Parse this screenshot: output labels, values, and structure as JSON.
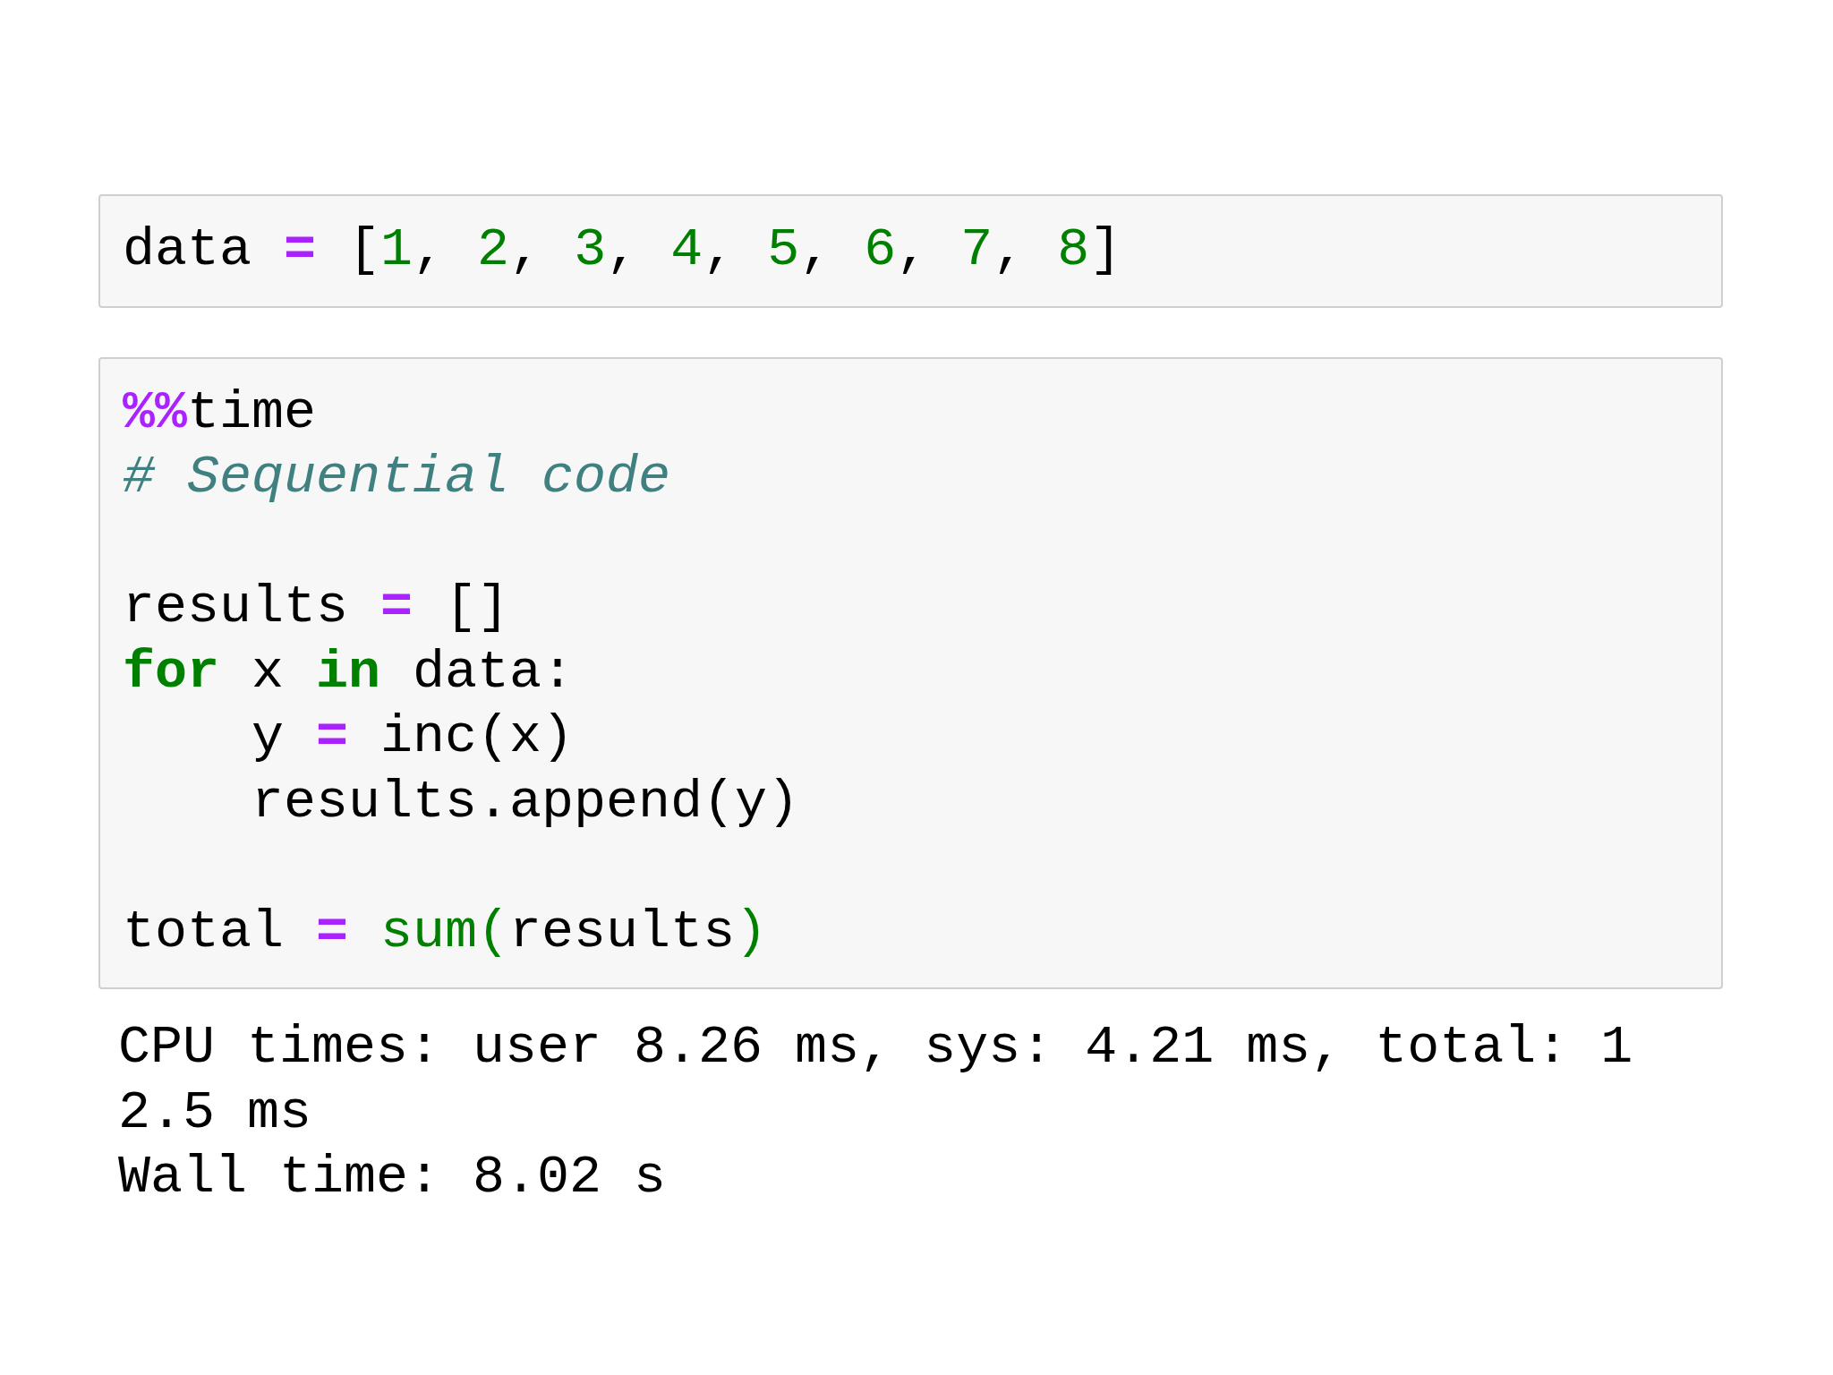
{
  "cells": [
    {
      "lines": [
        {
          "kind": "code",
          "tokens": [
            {
              "t": "data ",
              "kind": "name"
            },
            {
              "t": "=",
              "kind": "op"
            },
            {
              "t": " [",
              "kind": "name"
            },
            {
              "t": "1",
              "kind": "num"
            },
            {
              "t": ", ",
              "kind": "name"
            },
            {
              "t": "2",
              "kind": "num"
            },
            {
              "t": ", ",
              "kind": "name"
            },
            {
              "t": "3",
              "kind": "num"
            },
            {
              "t": ", ",
              "kind": "name"
            },
            {
              "t": "4",
              "kind": "num"
            },
            {
              "t": ", ",
              "kind": "name"
            },
            {
              "t": "5",
              "kind": "num"
            },
            {
              "t": ", ",
              "kind": "name"
            },
            {
              "t": "6",
              "kind": "num"
            },
            {
              "t": ", ",
              "kind": "name"
            },
            {
              "t": "7",
              "kind": "num"
            },
            {
              "t": ", ",
              "kind": "name"
            },
            {
              "t": "8",
              "kind": "num"
            },
            {
              "t": "]",
              "kind": "name"
            }
          ]
        }
      ]
    },
    {
      "lines": [
        {
          "kind": "code",
          "tokens": [
            {
              "t": "%%",
              "kind": "magic"
            },
            {
              "t": "time",
              "kind": "name"
            }
          ]
        },
        {
          "kind": "code",
          "tokens": [
            {
              "t": "# Sequential code",
              "kind": "comment"
            }
          ]
        },
        {
          "kind": "blank"
        },
        {
          "kind": "code",
          "tokens": [
            {
              "t": "results ",
              "kind": "name"
            },
            {
              "t": "=",
              "kind": "op"
            },
            {
              "t": " []",
              "kind": "name"
            }
          ]
        },
        {
          "kind": "code",
          "tokens": [
            {
              "t": "for",
              "kind": "kw"
            },
            {
              "t": " x ",
              "kind": "name"
            },
            {
              "t": "in",
              "kind": "kw"
            },
            {
              "t": " data:",
              "kind": "name"
            }
          ]
        },
        {
          "kind": "code",
          "tokens": [
            {
              "t": "    y ",
              "kind": "name"
            },
            {
              "t": "=",
              "kind": "op"
            },
            {
              "t": " inc(x)",
              "kind": "name"
            }
          ]
        },
        {
          "kind": "code",
          "tokens": [
            {
              "t": "    results.append(y)",
              "kind": "name"
            }
          ]
        },
        {
          "kind": "blank"
        },
        {
          "kind": "code",
          "tokens": [
            {
              "t": "total ",
              "kind": "name"
            },
            {
              "t": "= ",
              "kind": "op"
            },
            {
              "t": "sum(",
              "kind": "builtin"
            },
            {
              "t": "results",
              "kind": "name"
            },
            {
              "t": ")",
              "kind": "builtin"
            }
          ]
        }
      ],
      "output": [
        "CPU times: user 8.26 ms, sys: 4.21 ms, total: 1",
        "2.5 ms",
        "Wall time: 8.02 s"
      ]
    }
  ]
}
